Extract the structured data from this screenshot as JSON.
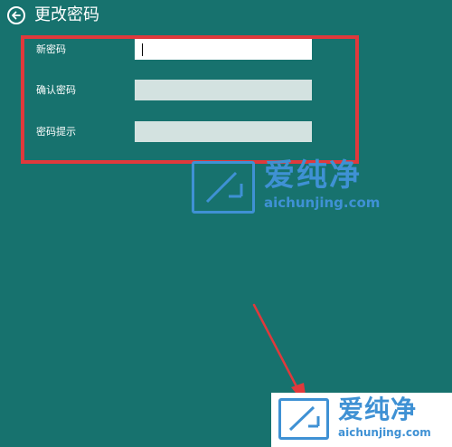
{
  "header": {
    "title": "更改密码",
    "back_icon": "back-arrow-icon"
  },
  "form": {
    "fields": [
      {
        "label": "新密码",
        "value": "",
        "state": "focused"
      },
      {
        "label": "确认密码",
        "value": "",
        "state": "idle"
      },
      {
        "label": "密码提示",
        "value": "",
        "state": "idle"
      }
    ]
  },
  "watermark": {
    "brand_text": "爱纯净",
    "site": "aichunjing.com"
  },
  "colors": {
    "background": "#17726e",
    "annotation": "#e0393c",
    "watermark": "#3f91d4",
    "input_active": "#ffffff",
    "input_inactive": "#d3e2e0"
  }
}
